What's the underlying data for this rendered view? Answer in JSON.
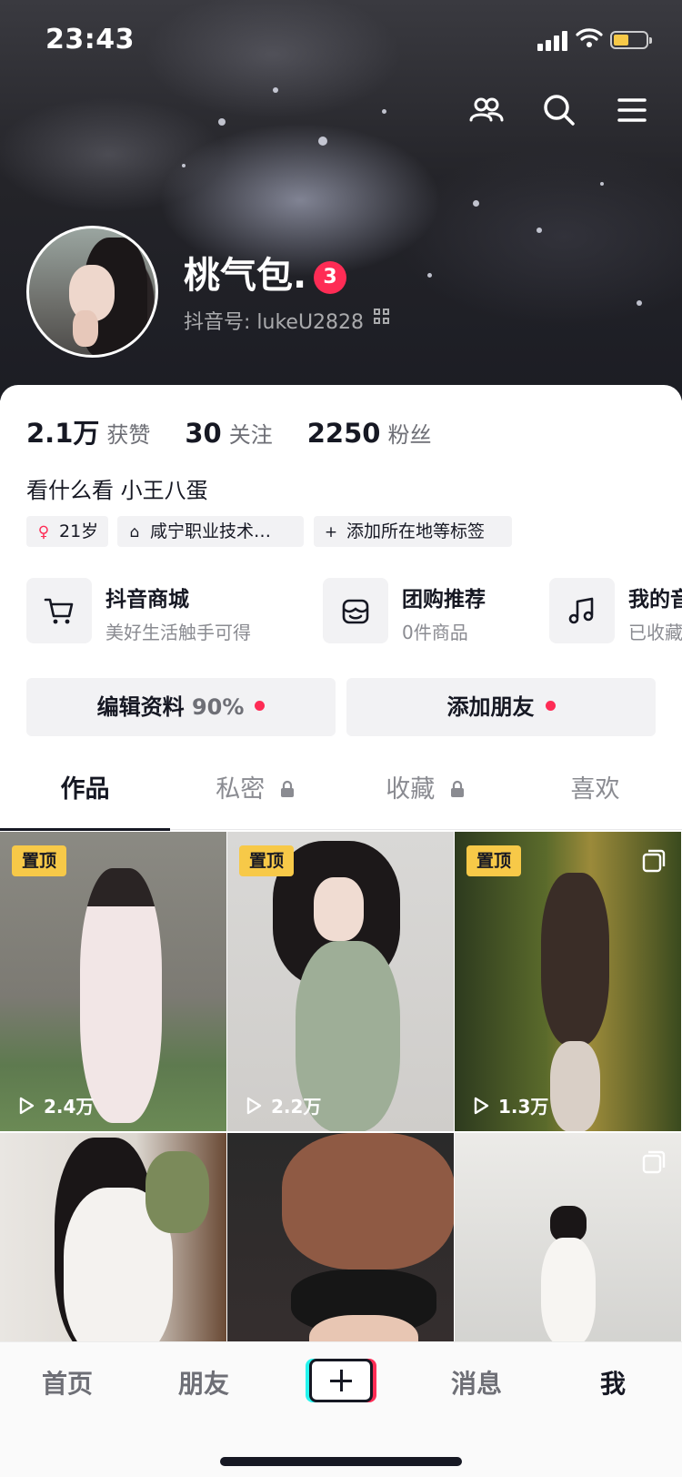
{
  "status_bar": {
    "time": "23:43"
  },
  "profile": {
    "nickname": "桃气包.",
    "badge_count": "3",
    "douyin_id": "抖音号: lukeU2828",
    "bio": "看什么看 小王八蛋"
  },
  "stats": [
    {
      "value": "2.1万",
      "label": "获赞"
    },
    {
      "value": "30",
      "label": "关注"
    },
    {
      "value": "2250",
      "label": "粉丝"
    }
  ],
  "tags": [
    {
      "icon": "gender-female-icon",
      "label": "21岁"
    },
    {
      "icon": "school-icon",
      "label": "咸宁职业技术…"
    },
    {
      "icon": "plus-icon",
      "label": "添加所在地等标签"
    }
  ],
  "services": [
    {
      "icon": "cart-icon",
      "title": "抖音商城",
      "subtitle": "美好生活触手可得"
    },
    {
      "icon": "group-buy-icon",
      "title": "团购推荐",
      "subtitle": "0件商品"
    },
    {
      "icon": "music-note-icon",
      "title": "我的音乐",
      "subtitle": "已收藏"
    }
  ],
  "buttons": {
    "edit_label": "编辑资料",
    "edit_percent": "90%",
    "add_friend_label": "添加朋友"
  },
  "tabs": [
    {
      "label": "作品",
      "locked": false,
      "active": true
    },
    {
      "label": "私密",
      "locked": true,
      "active": false
    },
    {
      "label": "收藏",
      "locked": true,
      "active": false
    },
    {
      "label": "喜欢",
      "locked": false,
      "active": false
    }
  ],
  "grid": {
    "pin_label": "置顶",
    "items": [
      {
        "pinned": true,
        "views": "2.4万",
        "multi": false
      },
      {
        "pinned": true,
        "views": "2.2万",
        "multi": false
      },
      {
        "pinned": true,
        "views": "1.3万",
        "multi": true
      },
      {
        "pinned": false,
        "views": "",
        "multi": false
      },
      {
        "pinned": false,
        "views": "",
        "multi": false
      },
      {
        "pinned": false,
        "views": "",
        "multi": true
      }
    ]
  },
  "bottom_nav": {
    "items": [
      {
        "label": "首页",
        "active": false
      },
      {
        "label": "朋友",
        "active": false
      },
      {
        "label": "消息",
        "active": false
      },
      {
        "label": "我",
        "active": true
      }
    ]
  },
  "colors": {
    "accent_red": "#fe2c55",
    "pin_yellow": "#f7c948",
    "text_dark": "#161823",
    "text_gray": "#8a8b91"
  }
}
